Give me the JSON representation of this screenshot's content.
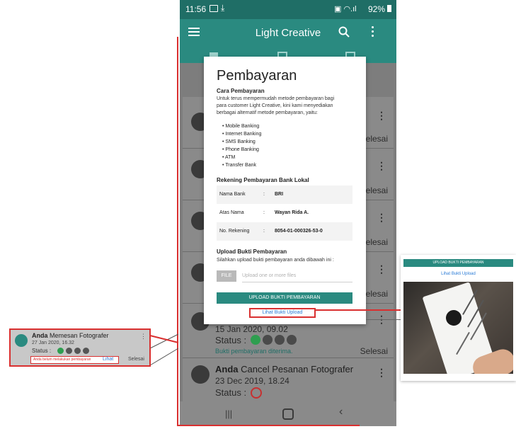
{
  "status_bar": {
    "time": "11:56",
    "battery": "92%"
  },
  "app_bar": {
    "title": "Light Creative",
    "menu_icon": "menu-icon",
    "search_icon": "search-icon",
    "overflow_icon": "more-vert-icon"
  },
  "list": {
    "selesai_label": "Selesai",
    "visible_card": {
      "date": "15 Jan 2020, 09.02",
      "status_label": "Status :",
      "note": "Bukti pembayaran diterima.",
      "selesai": "Selesai"
    },
    "cancel_card": {
      "actor": "Anda",
      "action": "Cancel Pesanan Fotografer",
      "date": "23 Dec 2019, 18.24",
      "status_label": "Status :"
    }
  },
  "dialog": {
    "title": "Pembayaran",
    "cara_heading": "Cara Pembayaran",
    "intro_line1": "Untuk terus mempermudah metode pembayaran bagi",
    "intro_line2": "para customer Light Creative, kini kami menyediakan",
    "intro_line3": "berbagai alternatif metode pembayaran, yaitu:",
    "methods": [
      "Mobile Banking",
      "Internet Banking",
      "SMS Banking",
      "Phone Banking",
      "ATM",
      "Transfer Bank"
    ],
    "rekening_heading": "Rekening Pembayaran Bank Lokal",
    "rows": [
      {
        "label": "Nama Bank",
        "sep": ":",
        "value": "BRI"
      },
      {
        "label": "Atas Nama",
        "sep": ":",
        "value": "Wayan Rida A."
      },
      {
        "label": "No. Rekening",
        "sep": ":",
        "value": "8054-01-000326-53-0"
      }
    ],
    "upload_heading": "Upload Bukti Pembayaran",
    "upload_instruction": "Silahkan upload bukti pembayaran anda dibawah ini :",
    "file_button": "FILE",
    "file_placeholder": "Upload one or more files",
    "upload_button": "UPLOAD BUKTI PEMBAYARAN",
    "view_link": "Lihat Bukti Upload"
  },
  "zoom_left": {
    "actor": "Anda",
    "action": "Memesan Fotografer",
    "date": "27 Jan 2020, 16.32",
    "status_label": "Status :",
    "warning": "Anda belum melakukan pembayaran",
    "link": "Lihat",
    "selesai": "Selesai"
  },
  "zoom_right": {
    "upload_button": "UPLOAD BUKTI PEMBAYARAN",
    "view_link": "Lihat Bukti Upload"
  },
  "colors": {
    "primary": "#2a8a80",
    "dark_primary": "#1f6e66",
    "accent_red": "#d93030",
    "link_blue": "#2a7bd6",
    "status_green": "#2e9e4f"
  }
}
